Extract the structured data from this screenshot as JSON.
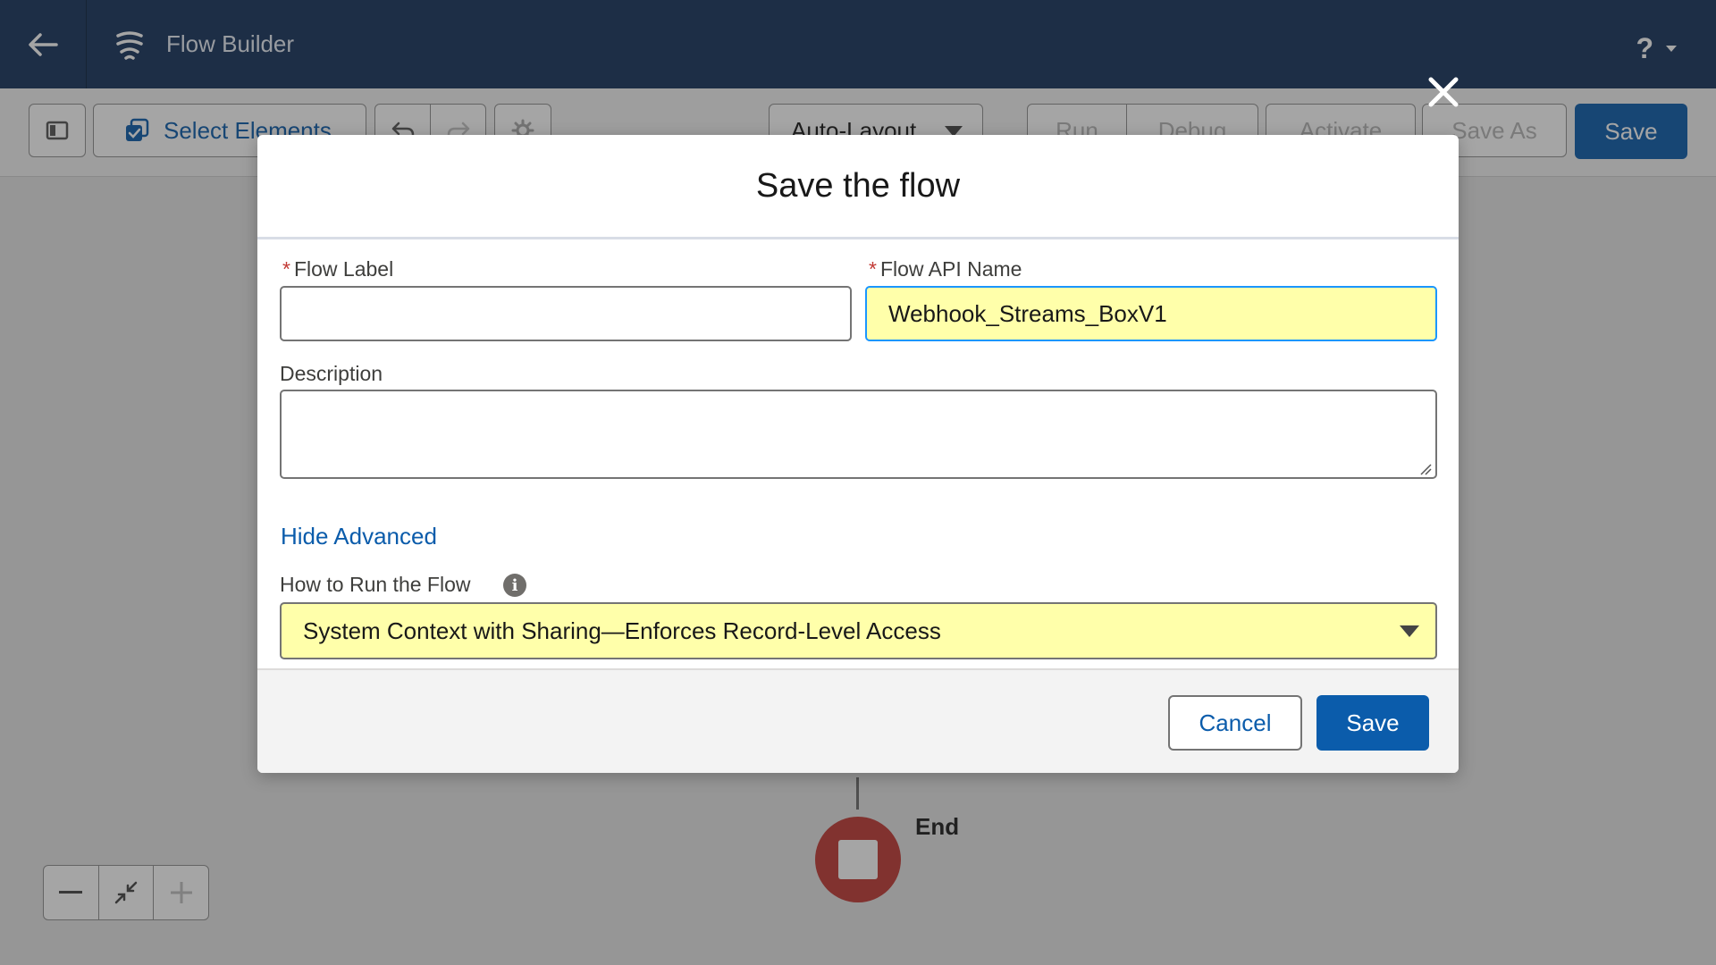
{
  "header": {
    "app_title": "Flow Builder",
    "help_label": "?"
  },
  "toolbar": {
    "select_elements_label": "Select Elements",
    "layout_select_value": "Auto-Layout",
    "run_label": "Run",
    "debug_label": "Debug",
    "activate_label": "Activate",
    "save_as_label": "Save As",
    "save_label": "Save"
  },
  "canvas": {
    "end_label": "End"
  },
  "modal": {
    "title": "Save the flow",
    "flow_label": {
      "label": "Flow Label",
      "required_mark": "*",
      "value": ""
    },
    "flow_api_name": {
      "label": "Flow API Name",
      "required_mark": "*",
      "value": "Webhook_Streams_BoxV1"
    },
    "description": {
      "label": "Description",
      "value": ""
    },
    "hide_advanced_label": "Hide Advanced",
    "run_mode": {
      "label": "How to Run the Flow",
      "info_icon": "i",
      "selected_value": "System Context with Sharing—Enforces Record-Level Access"
    },
    "cancel_label": "Cancel",
    "save_label": "Save"
  },
  "colors": {
    "header_bg": "#16325c",
    "brand_blue": "#0b5cab",
    "highlight_field": "#ffffaa",
    "end_node": "#c23934"
  }
}
